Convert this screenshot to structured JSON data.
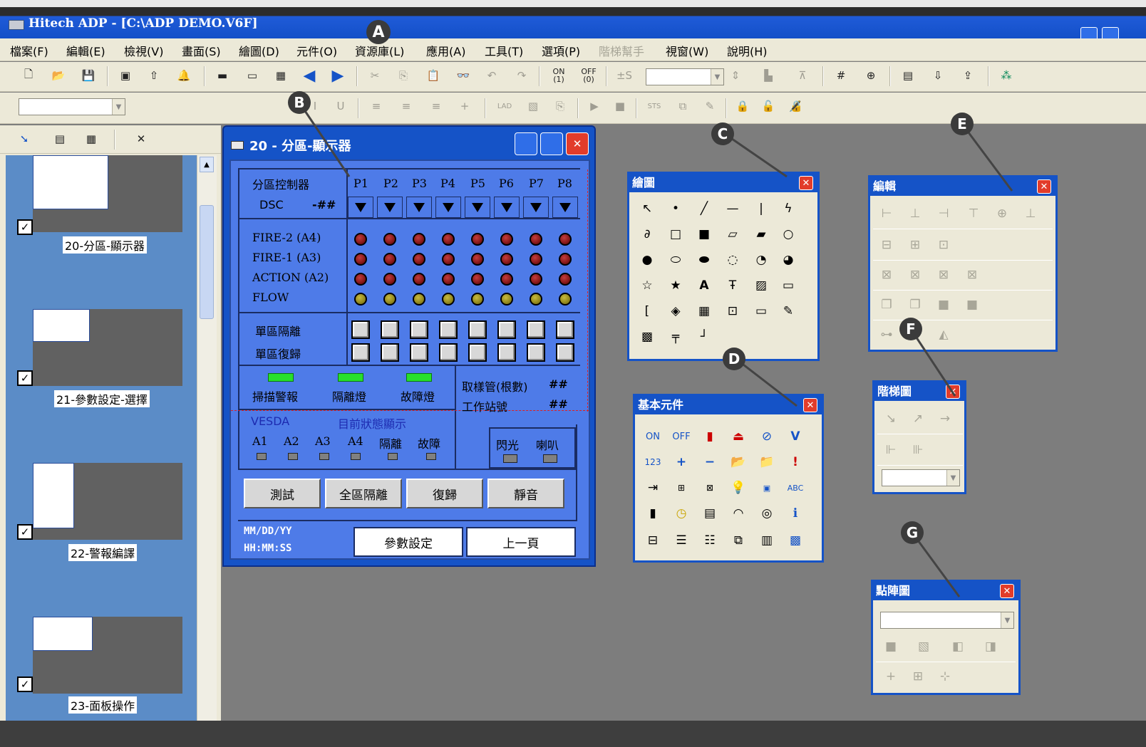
{
  "app": {
    "title": "Hitech ADP - [C:\\ADP DEMO.V6F]"
  },
  "menu": [
    "檔案(F)",
    "編輯(E)",
    "檢視(V)",
    "畫面(S)",
    "繪圖(D)",
    "元件(O)",
    "資源庫(L)",
    "應用(A)",
    "工具(T)",
    "選項(P)",
    "階梯幫手",
    "視窗(W)",
    "說明(H)"
  ],
  "toolbar1": {
    "on_label": "ON\n(1)",
    "off_label": "OFF\n(0)",
    "plus_s": "±S"
  },
  "toolbar2": {
    "lad_label": "LAD",
    "sts_label": "STS"
  },
  "annotations": [
    "A",
    "B",
    "C",
    "D",
    "E",
    "F",
    "G"
  ],
  "sidebar": {
    "pages": [
      {
        "label": "20-分區-顯示器",
        "checked": true
      },
      {
        "label": "21-參數設定-選擇",
        "checked": true
      },
      {
        "label": "22-警報編譯",
        "checked": true
      },
      {
        "label": "23-面板操作",
        "checked": true
      }
    ]
  },
  "main_window": {
    "title": "20 - 分區-顯示器",
    "panel": {
      "zone_controller": "分區控制器",
      "dsc": "DSC",
      "dsc_value": "-##",
      "ports": [
        "P1",
        "P2",
        "P3",
        "P4",
        "P5",
        "P6",
        "P7",
        "P8"
      ],
      "signals": [
        "FIRE-2  (A4)",
        "FIRE-1  (A3)",
        "ACTION (A2)",
        "FLOW"
      ],
      "isolate_single": "單區隔離",
      "reset_single": "單區復歸",
      "indicators": [
        "掃描警報",
        "隔離燈",
        "故障燈"
      ],
      "sampling_label": "取樣管(根數)",
      "sampling_value": "##",
      "station_label": "工作站號",
      "station_value": "##",
      "vesda_label": "VESDA",
      "status_label": "目前狀態顯示",
      "vesda_items": [
        "A1",
        "A2",
        "A3",
        "A4",
        "隔離",
        "故障"
      ],
      "flash": "閃光",
      "horn": "喇叭",
      "buttons": [
        "測試",
        "全區隔離",
        "復歸",
        "靜音"
      ],
      "date_format": "MM/DD/YY",
      "time_format": "HH:MM:SS",
      "param_button": "參數設定",
      "prev_button": "上一頁"
    }
  },
  "palettes": {
    "draw": {
      "title": "繪圖"
    },
    "basic": {
      "title": "基本元件",
      "on": "ON",
      "off": "OFF",
      "v": "V",
      "num": "123",
      "plus": "+",
      "minus": "−",
      "excl": "!",
      "abc": "ABC"
    },
    "edit": {
      "title": "編輯"
    },
    "ladder": {
      "title": "階梯圖"
    },
    "dotmatrix": {
      "title": "點陣圖"
    }
  },
  "colors": {
    "titlebar": "#1450c8",
    "panel": "#4e7be8",
    "led_red": "#8b0000",
    "led_yellow": "#a39a20",
    "indicator_green": "#28e02c"
  }
}
